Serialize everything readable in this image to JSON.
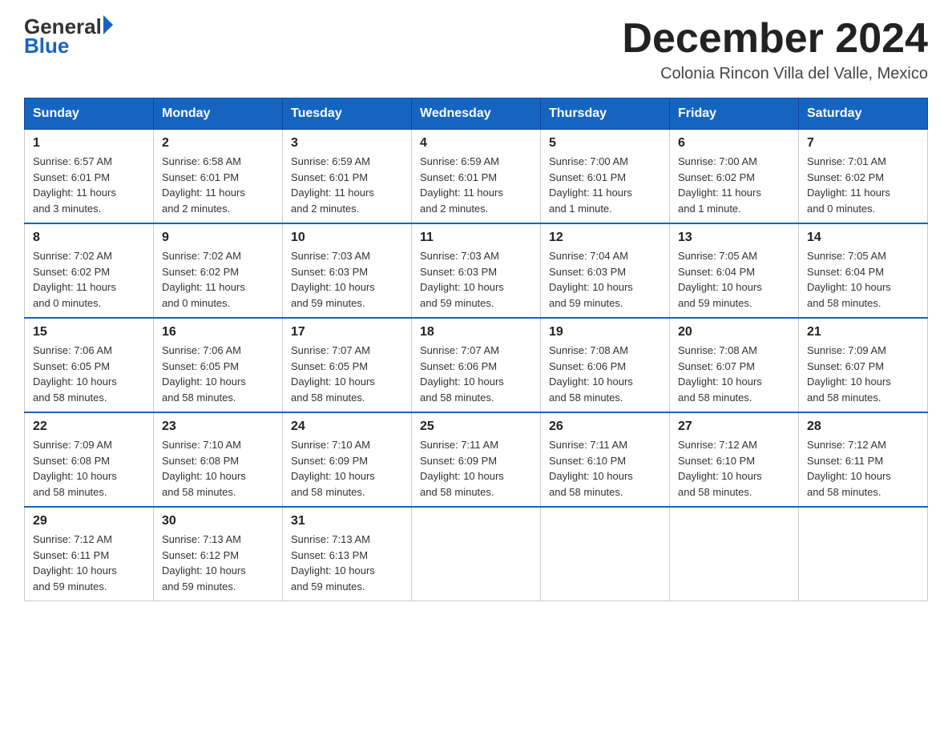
{
  "logo": {
    "general": "General",
    "blue": "Blue"
  },
  "title": "December 2024",
  "location": "Colonia Rincon Villa del Valle, Mexico",
  "days_header": [
    "Sunday",
    "Monday",
    "Tuesday",
    "Wednesday",
    "Thursday",
    "Friday",
    "Saturday"
  ],
  "weeks": [
    [
      {
        "day": "1",
        "info": "Sunrise: 6:57 AM\nSunset: 6:01 PM\nDaylight: 11 hours\nand 3 minutes."
      },
      {
        "day": "2",
        "info": "Sunrise: 6:58 AM\nSunset: 6:01 PM\nDaylight: 11 hours\nand 2 minutes."
      },
      {
        "day": "3",
        "info": "Sunrise: 6:59 AM\nSunset: 6:01 PM\nDaylight: 11 hours\nand 2 minutes."
      },
      {
        "day": "4",
        "info": "Sunrise: 6:59 AM\nSunset: 6:01 PM\nDaylight: 11 hours\nand 2 minutes."
      },
      {
        "day": "5",
        "info": "Sunrise: 7:00 AM\nSunset: 6:01 PM\nDaylight: 11 hours\nand 1 minute."
      },
      {
        "day": "6",
        "info": "Sunrise: 7:00 AM\nSunset: 6:02 PM\nDaylight: 11 hours\nand 1 minute."
      },
      {
        "day": "7",
        "info": "Sunrise: 7:01 AM\nSunset: 6:02 PM\nDaylight: 11 hours\nand 0 minutes."
      }
    ],
    [
      {
        "day": "8",
        "info": "Sunrise: 7:02 AM\nSunset: 6:02 PM\nDaylight: 11 hours\nand 0 minutes."
      },
      {
        "day": "9",
        "info": "Sunrise: 7:02 AM\nSunset: 6:02 PM\nDaylight: 11 hours\nand 0 minutes."
      },
      {
        "day": "10",
        "info": "Sunrise: 7:03 AM\nSunset: 6:03 PM\nDaylight: 10 hours\nand 59 minutes."
      },
      {
        "day": "11",
        "info": "Sunrise: 7:03 AM\nSunset: 6:03 PM\nDaylight: 10 hours\nand 59 minutes."
      },
      {
        "day": "12",
        "info": "Sunrise: 7:04 AM\nSunset: 6:03 PM\nDaylight: 10 hours\nand 59 minutes."
      },
      {
        "day": "13",
        "info": "Sunrise: 7:05 AM\nSunset: 6:04 PM\nDaylight: 10 hours\nand 59 minutes."
      },
      {
        "day": "14",
        "info": "Sunrise: 7:05 AM\nSunset: 6:04 PM\nDaylight: 10 hours\nand 58 minutes."
      }
    ],
    [
      {
        "day": "15",
        "info": "Sunrise: 7:06 AM\nSunset: 6:05 PM\nDaylight: 10 hours\nand 58 minutes."
      },
      {
        "day": "16",
        "info": "Sunrise: 7:06 AM\nSunset: 6:05 PM\nDaylight: 10 hours\nand 58 minutes."
      },
      {
        "day": "17",
        "info": "Sunrise: 7:07 AM\nSunset: 6:05 PM\nDaylight: 10 hours\nand 58 minutes."
      },
      {
        "day": "18",
        "info": "Sunrise: 7:07 AM\nSunset: 6:06 PM\nDaylight: 10 hours\nand 58 minutes."
      },
      {
        "day": "19",
        "info": "Sunrise: 7:08 AM\nSunset: 6:06 PM\nDaylight: 10 hours\nand 58 minutes."
      },
      {
        "day": "20",
        "info": "Sunrise: 7:08 AM\nSunset: 6:07 PM\nDaylight: 10 hours\nand 58 minutes."
      },
      {
        "day": "21",
        "info": "Sunrise: 7:09 AM\nSunset: 6:07 PM\nDaylight: 10 hours\nand 58 minutes."
      }
    ],
    [
      {
        "day": "22",
        "info": "Sunrise: 7:09 AM\nSunset: 6:08 PM\nDaylight: 10 hours\nand 58 minutes."
      },
      {
        "day": "23",
        "info": "Sunrise: 7:10 AM\nSunset: 6:08 PM\nDaylight: 10 hours\nand 58 minutes."
      },
      {
        "day": "24",
        "info": "Sunrise: 7:10 AM\nSunset: 6:09 PM\nDaylight: 10 hours\nand 58 minutes."
      },
      {
        "day": "25",
        "info": "Sunrise: 7:11 AM\nSunset: 6:09 PM\nDaylight: 10 hours\nand 58 minutes."
      },
      {
        "day": "26",
        "info": "Sunrise: 7:11 AM\nSunset: 6:10 PM\nDaylight: 10 hours\nand 58 minutes."
      },
      {
        "day": "27",
        "info": "Sunrise: 7:12 AM\nSunset: 6:10 PM\nDaylight: 10 hours\nand 58 minutes."
      },
      {
        "day": "28",
        "info": "Sunrise: 7:12 AM\nSunset: 6:11 PM\nDaylight: 10 hours\nand 58 minutes."
      }
    ],
    [
      {
        "day": "29",
        "info": "Sunrise: 7:12 AM\nSunset: 6:11 PM\nDaylight: 10 hours\nand 59 minutes."
      },
      {
        "day": "30",
        "info": "Sunrise: 7:13 AM\nSunset: 6:12 PM\nDaylight: 10 hours\nand 59 minutes."
      },
      {
        "day": "31",
        "info": "Sunrise: 7:13 AM\nSunset: 6:13 PM\nDaylight: 10 hours\nand 59 minutes."
      },
      null,
      null,
      null,
      null
    ]
  ]
}
